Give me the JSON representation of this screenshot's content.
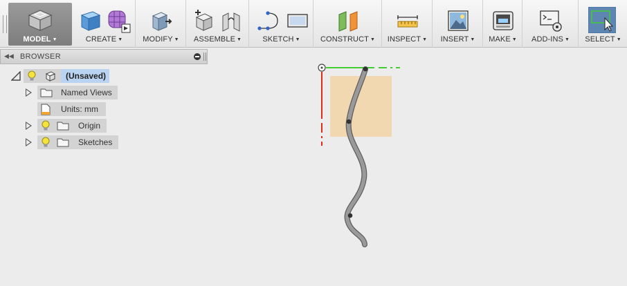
{
  "toolbar": {
    "groups": [
      {
        "id": "model",
        "label": "MODEL"
      },
      {
        "id": "create",
        "label": "CREATE"
      },
      {
        "id": "modify",
        "label": "MODIFY"
      },
      {
        "id": "assemble",
        "label": "ASSEMBLE"
      },
      {
        "id": "sketch",
        "label": "SKETCH"
      },
      {
        "id": "construct",
        "label": "CONSTRUCT"
      },
      {
        "id": "inspect",
        "label": "INSPECT"
      },
      {
        "id": "insert",
        "label": "INSERT"
      },
      {
        "id": "make",
        "label": "MAKE"
      },
      {
        "id": "addins",
        "label": "ADD-INS"
      },
      {
        "id": "select",
        "label": "SELECT"
      }
    ]
  },
  "browser": {
    "title": "BROWSER",
    "items": [
      {
        "label": "(Unsaved)",
        "icon": "component-icon",
        "visibility": "lightbulb-icon"
      },
      {
        "label": "Named Views",
        "icon": "folder-icon"
      },
      {
        "label": "Units: mm",
        "icon": "document-icon"
      },
      {
        "label": "Origin",
        "icon": "folder-icon",
        "visibility": "lightbulb-icon"
      },
      {
        "label": "Sketches",
        "icon": "folder-icon",
        "visibility": "lightbulb-icon"
      }
    ]
  },
  "colors": {
    "toolbar_top": "#f7f7f7",
    "toolbar_bottom": "#e4e4e4",
    "canvas_background": "#ececec",
    "selected_item": "#b9d3f0",
    "select_tool_active": "#5d86b3",
    "sketch_plane": "#f2d7ad",
    "axis_x": "#44cc33",
    "axis_y": "#e02b1b",
    "wire_body": "#8a8a8a"
  }
}
